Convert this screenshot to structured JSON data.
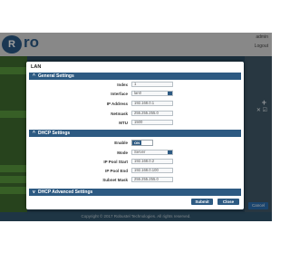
{
  "background": {
    "brand": "ro",
    "user_text": "admin",
    "logout": "Logout",
    "footer": "Copyright © 2017 Robustel Technologies. All rights reserved.",
    "cancel": "Cancel",
    "plus": "+",
    "actions": "✕ ☑"
  },
  "modal": {
    "title": "LAN",
    "general": {
      "heading": "General Settings",
      "rows": [
        {
          "label": "Index",
          "value": "1",
          "type": "input"
        },
        {
          "label": "Interface",
          "value": "lan0",
          "type": "select"
        },
        {
          "label": "IP Address",
          "value": "192.168.0.1",
          "type": "input"
        },
        {
          "label": "Netmask",
          "value": "255.255.255.0",
          "type": "input"
        },
        {
          "label": "MTU",
          "value": "1500",
          "type": "input"
        }
      ]
    },
    "dhcp": {
      "heading": "DHCP Settings",
      "enable_label": "Enable",
      "enable_state": "ON",
      "rows": [
        {
          "label": "Mode",
          "value": "Server",
          "type": "select"
        },
        {
          "label": "IP Pool Start",
          "value": "192.168.0.2",
          "type": "input"
        },
        {
          "label": "IP Pool End",
          "value": "192.168.0.100",
          "type": "input"
        },
        {
          "label": "Subnet Mask",
          "value": "255.255.255.0",
          "type": "input"
        }
      ]
    },
    "advanced": {
      "heading": "DHCP Advanced Settings"
    },
    "buttons": {
      "submit": "Submit",
      "close": "Close"
    }
  }
}
